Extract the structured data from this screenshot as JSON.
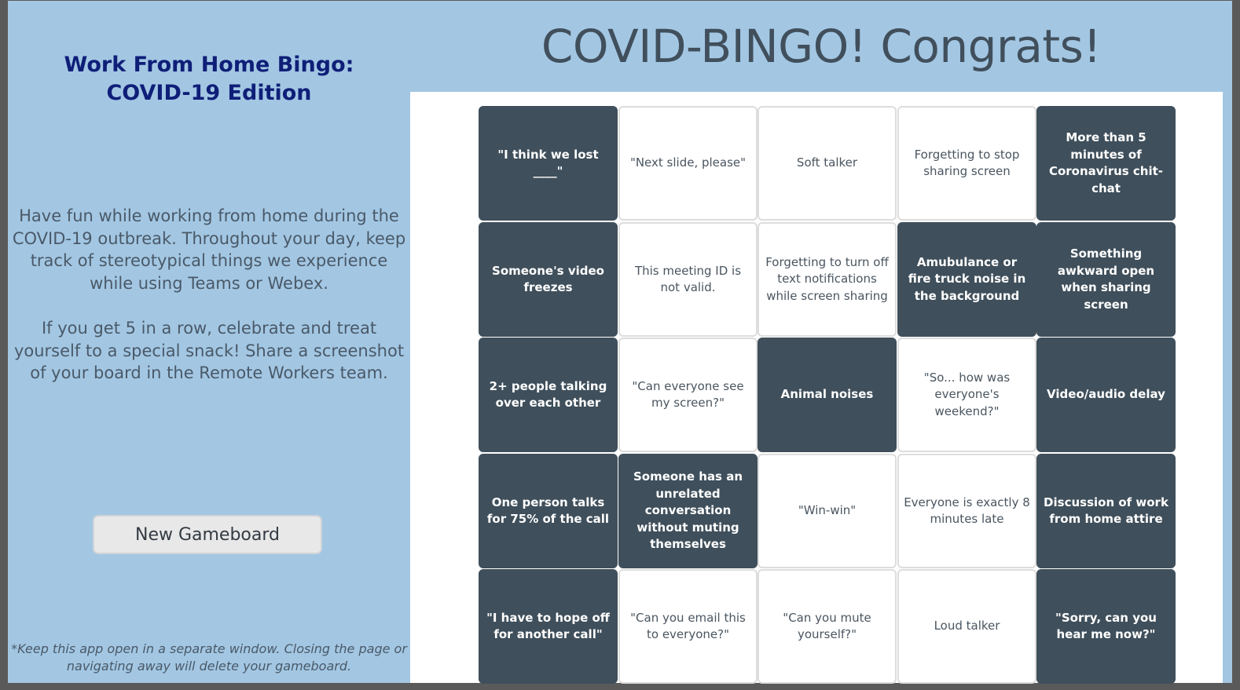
{
  "sidebar": {
    "title_line1": "Work From Home Bingo:",
    "title_line2": "COVID-19 Edition",
    "description_1": "Have fun while working from home during the COVID-19 outbreak. Throughout your day, keep track of stereotypical things we experience while using Teams or Webex.",
    "description_2": "If you get 5 in a row, celebrate and treat yourself to a special snack! Share a screenshot of your board in the Remote Workers team.",
    "new_button_label": "New Gameboard",
    "footnote": "*Keep this app open in a separate window. Closing the page or navigating away will delete your gameboard."
  },
  "header": {
    "congrats": "COVID-BINGO! Congrats!"
  },
  "colors": {
    "background": "#a3c7e3",
    "marked_cell": "#3f4f5b",
    "title": "#0f1f78"
  },
  "board": {
    "rows": [
      [
        {
          "text": "\"I think we lost ____\"",
          "marked": true
        },
        {
          "text": "\"Next slide, please\"",
          "marked": false
        },
        {
          "text": "Soft talker",
          "marked": false
        },
        {
          "text": "Forgetting to stop sharing screen",
          "marked": false
        },
        {
          "text": "More than 5 minutes of Coronavirus chit-chat",
          "marked": true
        }
      ],
      [
        {
          "text": "Someone's video freezes",
          "marked": true
        },
        {
          "text": "This meeting ID is not valid.",
          "marked": false
        },
        {
          "text": "Forgetting to turn off text notifications while screen sharing",
          "marked": false
        },
        {
          "text": "Amubulance or fire truck noise in the background",
          "marked": true
        },
        {
          "text": "Something awkward open when sharing screen",
          "marked": true
        }
      ],
      [
        {
          "text": "2+ people talking over each other",
          "marked": true
        },
        {
          "text": "\"Can everyone see my screen?\"",
          "marked": false
        },
        {
          "text": "Animal noises",
          "marked": true
        },
        {
          "text": "\"So... how was everyone's weekend?\"",
          "marked": false
        },
        {
          "text": "Video/audio delay",
          "marked": true
        }
      ],
      [
        {
          "text": "One person talks for 75% of the call",
          "marked": true
        },
        {
          "text": "Someone has an unrelated conversation without muting themselves",
          "marked": true
        },
        {
          "text": "\"Win-win\"",
          "marked": false
        },
        {
          "text": "Everyone is exactly 8 minutes late",
          "marked": false
        },
        {
          "text": "Discussion of work from home attire",
          "marked": true
        }
      ],
      [
        {
          "text": "\"I have to hope off for another call\"",
          "marked": true
        },
        {
          "text": "\"Can you email this to everyone?\"",
          "marked": false
        },
        {
          "text": "\"Can you mute yourself?\"",
          "marked": false
        },
        {
          "text": "Loud talker",
          "marked": false
        },
        {
          "text": "\"Sorry, can you hear me now?\"",
          "marked": true
        }
      ]
    ]
  }
}
